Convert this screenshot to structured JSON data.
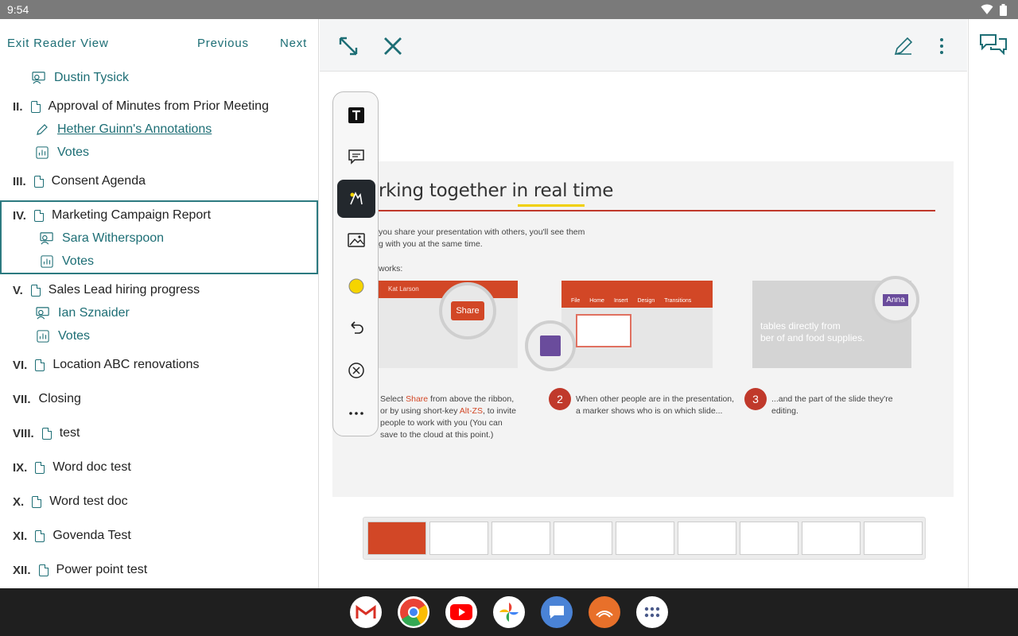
{
  "status": {
    "time": "9:54"
  },
  "nav": {
    "exit": "Exit Reader View",
    "previous": "Previous",
    "next": "Next"
  },
  "agenda": {
    "presenter0": "Dustin Tysick",
    "items": [
      {
        "num": "II.",
        "title": "Approval of Minutes from Prior Meeting",
        "sub1": "Hether Guinn's Annotations",
        "sub2": "Votes"
      },
      {
        "num": "III.",
        "title": "Consent Agenda"
      },
      {
        "num": "IV.",
        "title": "Marketing Campaign Report",
        "sub1": "Sara Witherspoon",
        "sub2": "Votes"
      },
      {
        "num": "V.",
        "title": "Sales Lead hiring progress",
        "sub1": "Ian Sznaider",
        "sub2": "Votes"
      },
      {
        "num": "VI.",
        "title": "Location ABC renovations"
      },
      {
        "num": "VII.",
        "title": "Closing"
      },
      {
        "num": "VIII.",
        "title": "test"
      },
      {
        "num": "IX.",
        "title": "Word doc test"
      },
      {
        "num": "X.",
        "title": "Word test doc"
      },
      {
        "num": "XI.",
        "title": "Govenda Test"
      },
      {
        "num": "XII.",
        "title": "Power point test"
      }
    ]
  },
  "slide": {
    "title_pre": "rking together in ",
    "title_hl": "real time",
    "intro1": "you share your presentation with others, you'll see them",
    "intro2": "g with you at the same time.",
    "works": "works:",
    "p1_name": "Kat Larson",
    "share": "Share",
    "anna": "Anna",
    "p3_text1": "tables directly from",
    "p3_text2": "ber of and food supplies.",
    "p2_menu": [
      "File",
      "Home",
      "Insert",
      "Design",
      "Transitions"
    ],
    "step1_a": "Select ",
    "step1_b": "Share",
    "step1_c": " from above the ribbon,",
    "step1_d": "or by using short-key ",
    "step1_e": "Alt-ZS",
    "step1_f": ", to invite",
    "step1_g": "people to work with you (You can",
    "step1_h": "save to the cloud at this point.)",
    "step2_num": "2",
    "step2_a": "When other people are in the presentation,",
    "step2_b": "a marker shows who is on which slide...",
    "step3_num": "3",
    "step3_a": "...and the part of the slide they're",
    "step3_b": "editing."
  },
  "colors": {
    "teal": "#1d6e75",
    "accent_red": "#c0392b",
    "highlight": "#f5d400"
  }
}
